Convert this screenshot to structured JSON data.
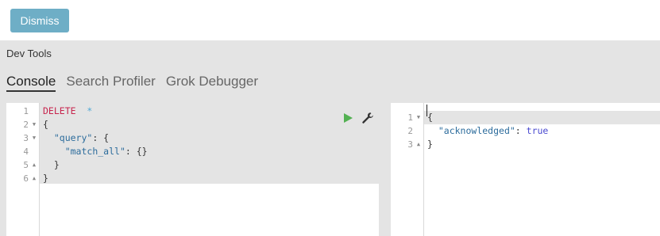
{
  "dismiss_label": "Dismiss",
  "devtools": {
    "title": "Dev Tools",
    "tabs": [
      {
        "label": "Console",
        "active": true
      },
      {
        "label": "Search Profiler",
        "active": false
      },
      {
        "label": "Grok Debugger",
        "active": false
      }
    ]
  },
  "request_editor": {
    "line_numbers": [
      "1",
      "2",
      "3",
      "4",
      "5",
      "6"
    ],
    "method": "DELETE",
    "path": "*",
    "lines": {
      "l2": "{",
      "l3_key": "\"query\"",
      "l3_rest": ": {",
      "l4_key": "\"match_all\"",
      "l4_rest": ": {}",
      "l5": "}",
      "l6": "}"
    },
    "actions": [
      "play-icon",
      "wrench-icon"
    ]
  },
  "response_viewer": {
    "line_numbers": [
      "1",
      "2",
      "3"
    ],
    "lines": {
      "l1": "{",
      "l2_key": "\"acknowledged\"",
      "l2_sep": ": ",
      "l2_value": "true",
      "l3": "}"
    }
  },
  "colors": {
    "button": "#6eaec6",
    "method": "#c7254e",
    "path": "#4fa8d6",
    "string_key": "#2c6c9c",
    "play": "#53b152"
  }
}
